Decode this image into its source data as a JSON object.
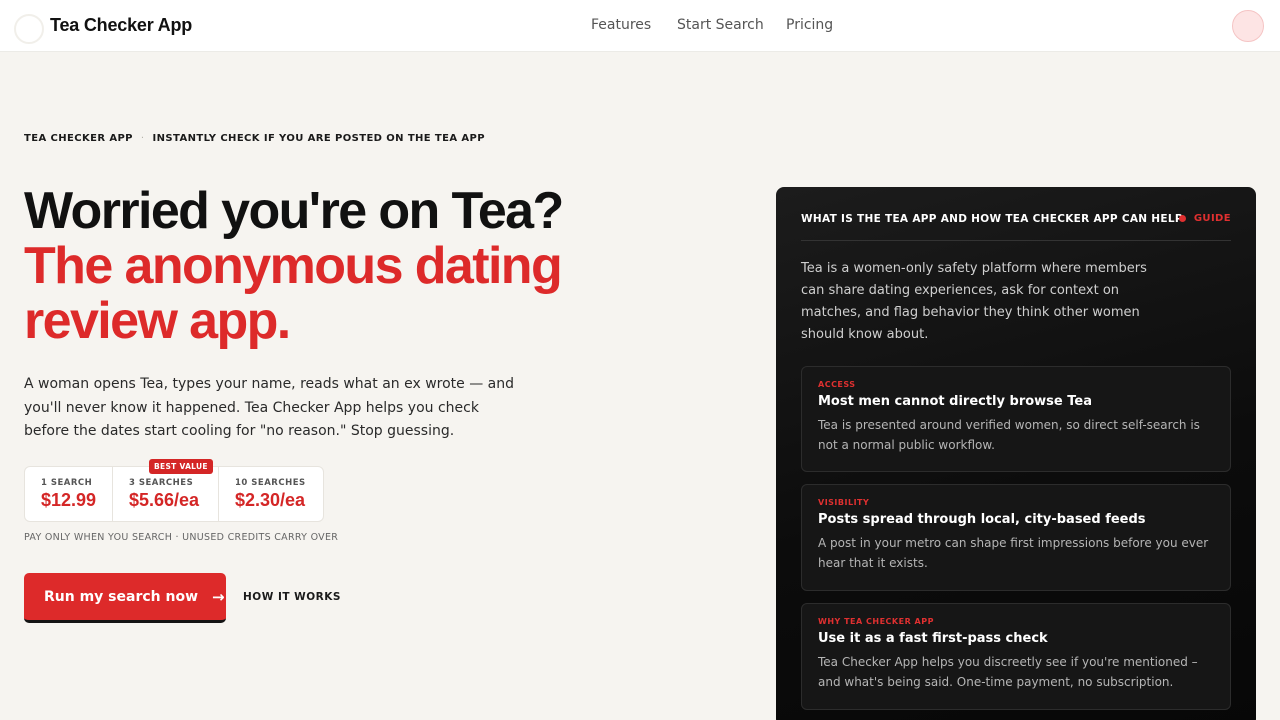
{
  "header": {
    "brand": "Tea Checker App",
    "nav": [
      {
        "label": "Features"
      },
      {
        "label": "Start Search"
      },
      {
        "label": "Pricing"
      }
    ]
  },
  "breadcrumb": {
    "items": [
      "TEA CHECKER APP",
      "INSTANTLY CHECK IF YOU ARE POSTED ON THE TEA APP"
    ]
  },
  "hero": {
    "title_dark": "Worried you're on Tea?",
    "title_red_line1": "The anonymous dating",
    "title_red_line2": "review app.",
    "subcopy": "A woman opens Tea, types your name, reads what an ex wrote — and you'll never know it happened. Tea Checker App helps you check before the dates start cooling for \"no reason.\" Stop guessing."
  },
  "pricing": {
    "options": [
      {
        "label": "1 SEARCH",
        "price": "$12.99"
      },
      {
        "label": "3 SEARCHES",
        "price": "$5.66/ea"
      },
      {
        "label": "10 SEARCHES",
        "price": "$2.30/ea"
      }
    ],
    "badge": "BEST VALUE",
    "note": "PAY ONLY WHEN YOU SEARCH · UNUSED CREDITS CARRY OVER"
  },
  "cta": {
    "primary_label": "Run my search now",
    "secondary_label": "HOW IT WORKS"
  },
  "panel": {
    "heading": "WHAT IS THE TEA APP AND HOW TEA CHECKER APP CAN HELP",
    "tag": "GUIDE",
    "intro": "Tea is a women-only safety platform where members can share dating experiences, ask for context on matches, and flag behavior they think other women should know about.",
    "cards": [
      {
        "tag": "ACCESS",
        "title": "Most men cannot directly browse Tea",
        "text": "Tea is presented around verified women, so direct self-search is not a normal public workflow."
      },
      {
        "tag": "VISIBILITY",
        "title": "Posts spread through local, city-based feeds",
        "text": "A post in your metro can shape first impressions before you ever hear that it exists."
      },
      {
        "tag": "WHY TEA CHECKER APP",
        "title": "Use it as a fast first-pass check",
        "text": "Tea Checker App helps you discreetly see if you're mentioned – and what's being said. One-time payment, no subscription."
      }
    ]
  },
  "colors": {
    "accent": "#dd2a2a",
    "background": "#f6f4f0",
    "panel": "#0c0c0c"
  }
}
